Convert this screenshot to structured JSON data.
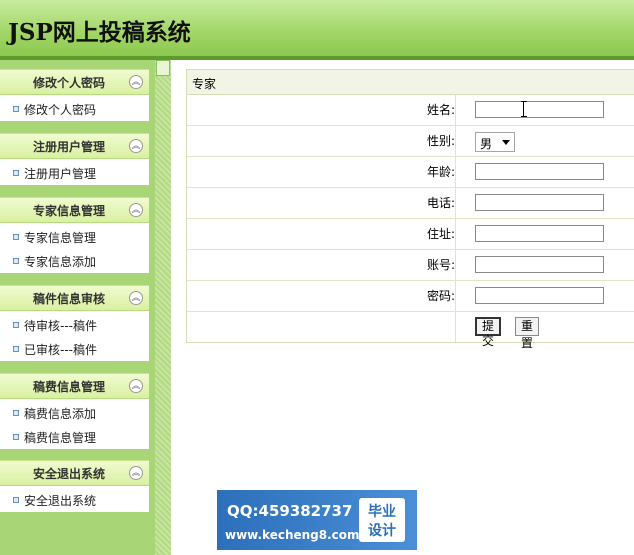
{
  "app": {
    "title": "JSP网上投稿系统"
  },
  "sidebar": {
    "sections": [
      {
        "title": "修改个人密码",
        "items": [
          "修改个人密码"
        ]
      },
      {
        "title": "注册用户管理",
        "items": [
          "注册用户管理"
        ]
      },
      {
        "title": "专家信息管理",
        "items": [
          "专家信息管理",
          "专家信息添加"
        ]
      },
      {
        "title": "稿件信息审核",
        "items": [
          "待审核---稿件",
          "已审核---稿件"
        ]
      },
      {
        "title": "稿费信息管理",
        "items": [
          "稿费信息添加",
          "稿费信息管理"
        ]
      },
      {
        "title": "安全退出系统",
        "items": [
          "安全退出系统"
        ]
      }
    ],
    "collapse_glyph": "︽"
  },
  "form": {
    "title": "专家",
    "fields": {
      "name": {
        "label": "姓名:",
        "value": ""
      },
      "gender": {
        "label": "性别:",
        "value": "男"
      },
      "age": {
        "label": "年龄:",
        "value": ""
      },
      "phone": {
        "label": "电话:",
        "value": ""
      },
      "address": {
        "label": "住址:",
        "value": ""
      },
      "account": {
        "label": "账号:",
        "value": ""
      },
      "password": {
        "label": "密码:",
        "value": ""
      }
    },
    "submit_label": "提交",
    "reset_label": "重置"
  },
  "watermark": {
    "qq": "QQ:459382737",
    "url": "www.kecheng8.com",
    "seal_line1": "毕业",
    "seal_line2": "设计"
  }
}
